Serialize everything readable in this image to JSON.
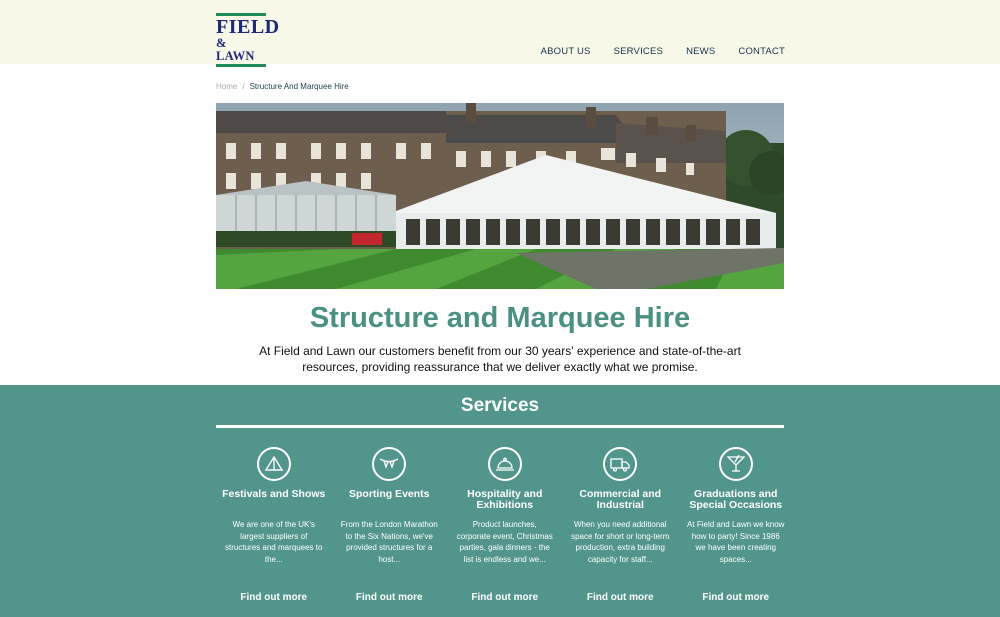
{
  "logo": {
    "line1": "FIELD",
    "line2": "& LAWN"
  },
  "nav": [
    "ABOUT US",
    "SERVICES",
    "NEWS",
    "CONTACT"
  ],
  "breadcrumb": {
    "home": "Home",
    "separator": "/",
    "current": "Structure And Marquee Hire"
  },
  "hero": {
    "image": "marquee-beside-hotel-photo"
  },
  "page_title": "Structure and Marquee Hire",
  "intro": "At Field and Lawn our customers benefit from our 30 years' experience and state-of-the-art resources, providing reassurance that we deliver exactly what we promise.",
  "services": {
    "heading": "Services",
    "cards": [
      {
        "icon": "tent-icon",
        "title": "Festivals and Shows",
        "desc": "We are one of the UK's largest suppliers of structures and marquees to the...",
        "link": "Find out more"
      },
      {
        "icon": "bunting-icon",
        "title": "Sporting Events",
        "desc": "From the London Marathon to the Six Nations, we've provided structures for a host...",
        "link": "Find out more"
      },
      {
        "icon": "cloche-icon",
        "title": "Hospitality and Exhibitions",
        "desc": "Product launches, corporate event, Christmas parties, gala dinners - the list is endless and we...",
        "link": "Find out more"
      },
      {
        "icon": "truck-icon",
        "title": "Commercial and Industrial",
        "desc": "When you need additional space for short or long-term production, extra building capacity for staff...",
        "link": "Find out more"
      },
      {
        "icon": "cocktail-icon",
        "title": "Graduations and Special Occasions",
        "desc": "At Field and Lawn we know how to party! Since 1986 we have been creating spaces...",
        "link": "Find out more"
      }
    ]
  },
  "colors": {
    "header_bg": "#f8f8e9",
    "teal": "#52958a",
    "title": "#4a9183",
    "logo_blue": "#1e2a78",
    "logo_green": "#1f8a5a"
  }
}
